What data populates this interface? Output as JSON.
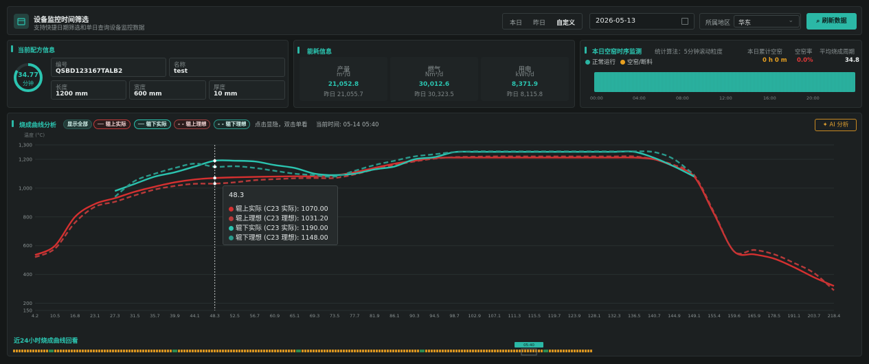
{
  "header": {
    "title": "设备监控时间筛选",
    "subtitle": "支持快捷日期筛选和单日查询设备监控数据",
    "tabs": [
      {
        "label": "本日",
        "active": false
      },
      {
        "label": "昨日",
        "active": false
      },
      {
        "label": "自定义",
        "active": true
      }
    ],
    "date": "2026-05-13",
    "region_label": "所属地区",
    "region_value": "华东",
    "refresh_label": "刷新数据"
  },
  "recipe": {
    "title": "当前配方信息",
    "ring_value": "34.77",
    "ring_unit": "分钟",
    "fields": [
      {
        "label": "编号",
        "value": "QSBD123167TALB2"
      },
      {
        "label": "名称",
        "value": "test"
      },
      {
        "label": "长度",
        "value": "1200 mm"
      },
      {
        "label": "宽度",
        "value": "600 mm"
      },
      {
        "label": "厚度",
        "value": "10 mm"
      }
    ]
  },
  "energy": {
    "title": "能耗信息",
    "items": [
      {
        "name": "产量",
        "unit": "m²/d",
        "value": "21,052.8",
        "yesterday": "昨日 21,055.7"
      },
      {
        "name": "燃气",
        "unit": "Nm³/d",
        "value": "30,012.6",
        "yesterday": "昨日 30,323.5"
      },
      {
        "name": "用电",
        "unit": "kWh/d",
        "value": "8,371.9",
        "yesterday": "昨日 8,115.8"
      }
    ]
  },
  "idle": {
    "title": "本日空窑时序监测",
    "algo": "统计算法：5分钟滚动粒度",
    "legend_running": "正常运行",
    "legend_idle": "空窑/断料",
    "stats": [
      {
        "label": "本日累计空窑",
        "value": "0 h 0 m"
      },
      {
        "label": "空窑率",
        "value": "0.0%"
      },
      {
        "label": "平均烧成周期",
        "value": "34.8"
      }
    ],
    "ticks": [
      "00:00",
      "04:00",
      "08:00",
      "12:00",
      "16:00",
      "20:00"
    ],
    "colors": {
      "running": "#2ab5a3",
      "idle": "#e8a020"
    }
  },
  "curve": {
    "title": "烧成曲线分析",
    "buttons": [
      "显示全部",
      "辊上实际",
      "辊下实际",
      "辊上理想",
      "辊下理想"
    ],
    "hint": "点击显隐，双击单看",
    "current_time": "当前时间: 05-14 05:40",
    "ai_label": "AI 分析",
    "history_title": "近24小时烧成曲线回看",
    "history_marker": "05:40"
  },
  "tooltip": {
    "title": "48.3",
    "rows": [
      "辊上实际 (C23 实际): 1070.00",
      "辊上理想 (C23 理想): 1031.20",
      "辊下实际 (C23 实际): 1190.00",
      "辊下理想 (C23 理想): 1148.00"
    ]
  },
  "chart_data": {
    "type": "line",
    "ylabel": "温度 (°C)",
    "ylim": [
      150,
      1300
    ],
    "yticks": [
      150,
      200,
      400,
      600,
      800,
      1000,
      1200,
      1300
    ],
    "grid": true,
    "x_labels": [
      "4.2",
      "10.5",
      "16.8",
      "23.1",
      "27.3",
      "31.5",
      "35.7",
      "39.9",
      "44.1",
      "48.3",
      "52.5",
      "56.7",
      "60.9",
      "65.1",
      "69.3",
      "73.5",
      "77.7",
      "81.9",
      "86.1",
      "90.3",
      "94.5",
      "98.7",
      "102.9",
      "107.1",
      "111.3",
      "115.5",
      "119.7",
      "123.9",
      "128.1",
      "132.3",
      "136.5",
      "140.7",
      "144.9",
      "149.1",
      "155.4",
      "159.6",
      "165.9",
      "178.5",
      "191.1",
      "203.7",
      "218.4"
    ],
    "series": [
      {
        "name": "辊上实际",
        "color": "#d63030",
        "dashed": false,
        "values": [
          535,
          600,
          800,
          890,
          930,
          975,
          1010,
          1040,
          1060,
          1070,
          1075,
          1078,
          1080,
          1082,
          1082,
          1088,
          1110,
          1140,
          1170,
          1190,
          1210,
          1212,
          1212,
          1212,
          1212,
          1212,
          1212,
          1212,
          1212,
          1212,
          1212,
          1200,
          1150,
          1080,
          820,
          560,
          540,
          510,
          450,
          380,
          320
        ]
      },
      {
        "name": "辊上理想",
        "color": "#b83a3a",
        "dashed": true,
        "values": [
          520,
          580,
          760,
          870,
          905,
          950,
          990,
          1015,
          1030,
          1031,
          1040,
          1055,
          1062,
          1068,
          1070,
          1070,
          1095,
          1130,
          1160,
          1185,
          1205,
          1215,
          1218,
          1220,
          1220,
          1220,
          1220,
          1220,
          1220,
          1220,
          1220,
          1200,
          1160,
          1090,
          830,
          560,
          570,
          540,
          480,
          410,
          290
        ]
      },
      {
        "name": "辊下实际",
        "color": "#2bc4b0",
        "dashed": false,
        "values": [
          null,
          null,
          null,
          null,
          980,
          1030,
          1080,
          1110,
          1150,
          1190,
          1190,
          1185,
          1160,
          1140,
          1100,
          1090,
          1100,
          1130,
          1150,
          1200,
          1215,
          1250,
          1252,
          1252,
          1252,
          1252,
          1252,
          1252,
          1252,
          1252,
          1252,
          1210,
          1150,
          1080,
          null,
          null,
          null,
          null,
          null,
          null,
          null
        ]
      },
      {
        "name": "辊下理想",
        "color": "#2a9a8c",
        "dashed": true,
        "values": [
          null,
          null,
          null,
          null,
          940,
          1050,
          1100,
          1140,
          1170,
          1148,
          1152,
          1140,
          1120,
          1100,
          1090,
          1080,
          1120,
          1160,
          1190,
          1220,
          1235,
          1250,
          1255,
          1255,
          1255,
          1255,
          1255,
          1255,
          1255,
          1255,
          1255,
          1250,
          1200,
          1090,
          null,
          null,
          null,
          null,
          null,
          null,
          null
        ]
      }
    ]
  }
}
